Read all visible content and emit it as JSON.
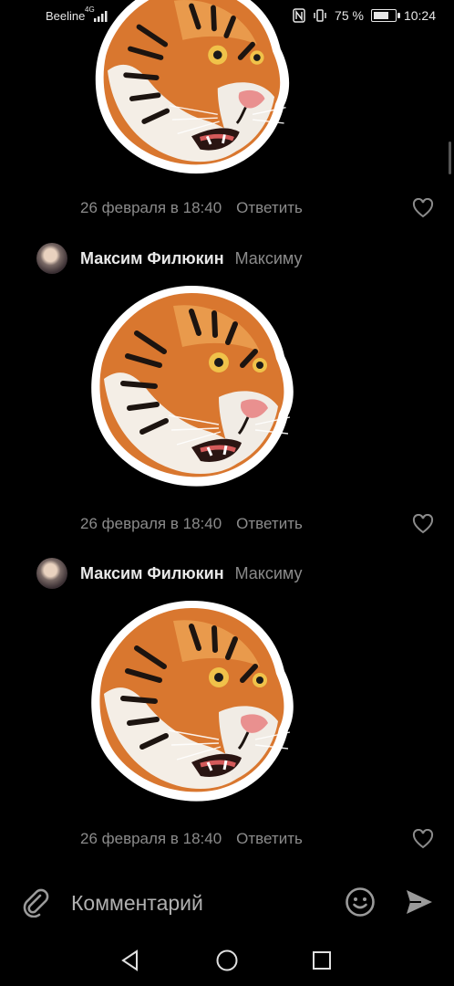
{
  "status_bar": {
    "carrier": "Beeline",
    "network": "4G",
    "battery": "75 %",
    "battery_level": 0.75,
    "time": "10:24"
  },
  "comments": [
    {
      "timestamp": "26 февраля в 18:40",
      "reply_label": "Ответить",
      "sticker_icon": "tiger-head-sticker"
    },
    {
      "author": "Максим Филюкин",
      "recipient": "Максиму",
      "timestamp": "26 февраля в 18:40",
      "reply_label": "Ответить",
      "sticker_icon": "tiger-head-sticker"
    },
    {
      "author": "Максим Филюкин",
      "recipient": "Максиму",
      "timestamp": "26 февраля в 18:40",
      "reply_label": "Ответить",
      "sticker_icon": "tiger-head-sticker"
    }
  ],
  "comment_input": {
    "placeholder": "Комментарий"
  },
  "colors": {
    "background": "#000000",
    "meta_text": "#8b8b8b",
    "author_text": "#e9e9e9"
  }
}
